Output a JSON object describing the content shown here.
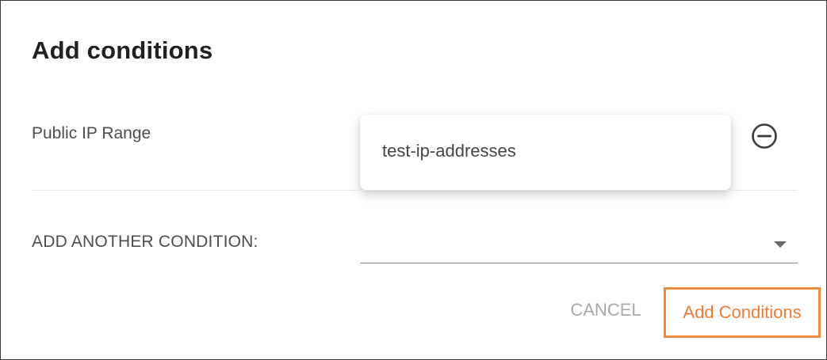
{
  "dialog": {
    "title": "Add conditions"
  },
  "condition": {
    "label": "Public IP Range",
    "options": [
      "test-ip-addresses"
    ],
    "remove_icon": "minus-circle-icon"
  },
  "add_another": {
    "label": "ADD ANOTHER CONDITION:",
    "value": "",
    "arrow_icon": "dropdown-arrow-icon"
  },
  "actions": {
    "cancel_label": "CANCEL",
    "add_label": "Add Conditions"
  },
  "colors": {
    "accent": "#f07b2f",
    "highlight_border": "#f08a3c",
    "text_primary": "#212121",
    "text_secondary": "#4d4d4d",
    "text_disabled": "#a8a8a8"
  }
}
